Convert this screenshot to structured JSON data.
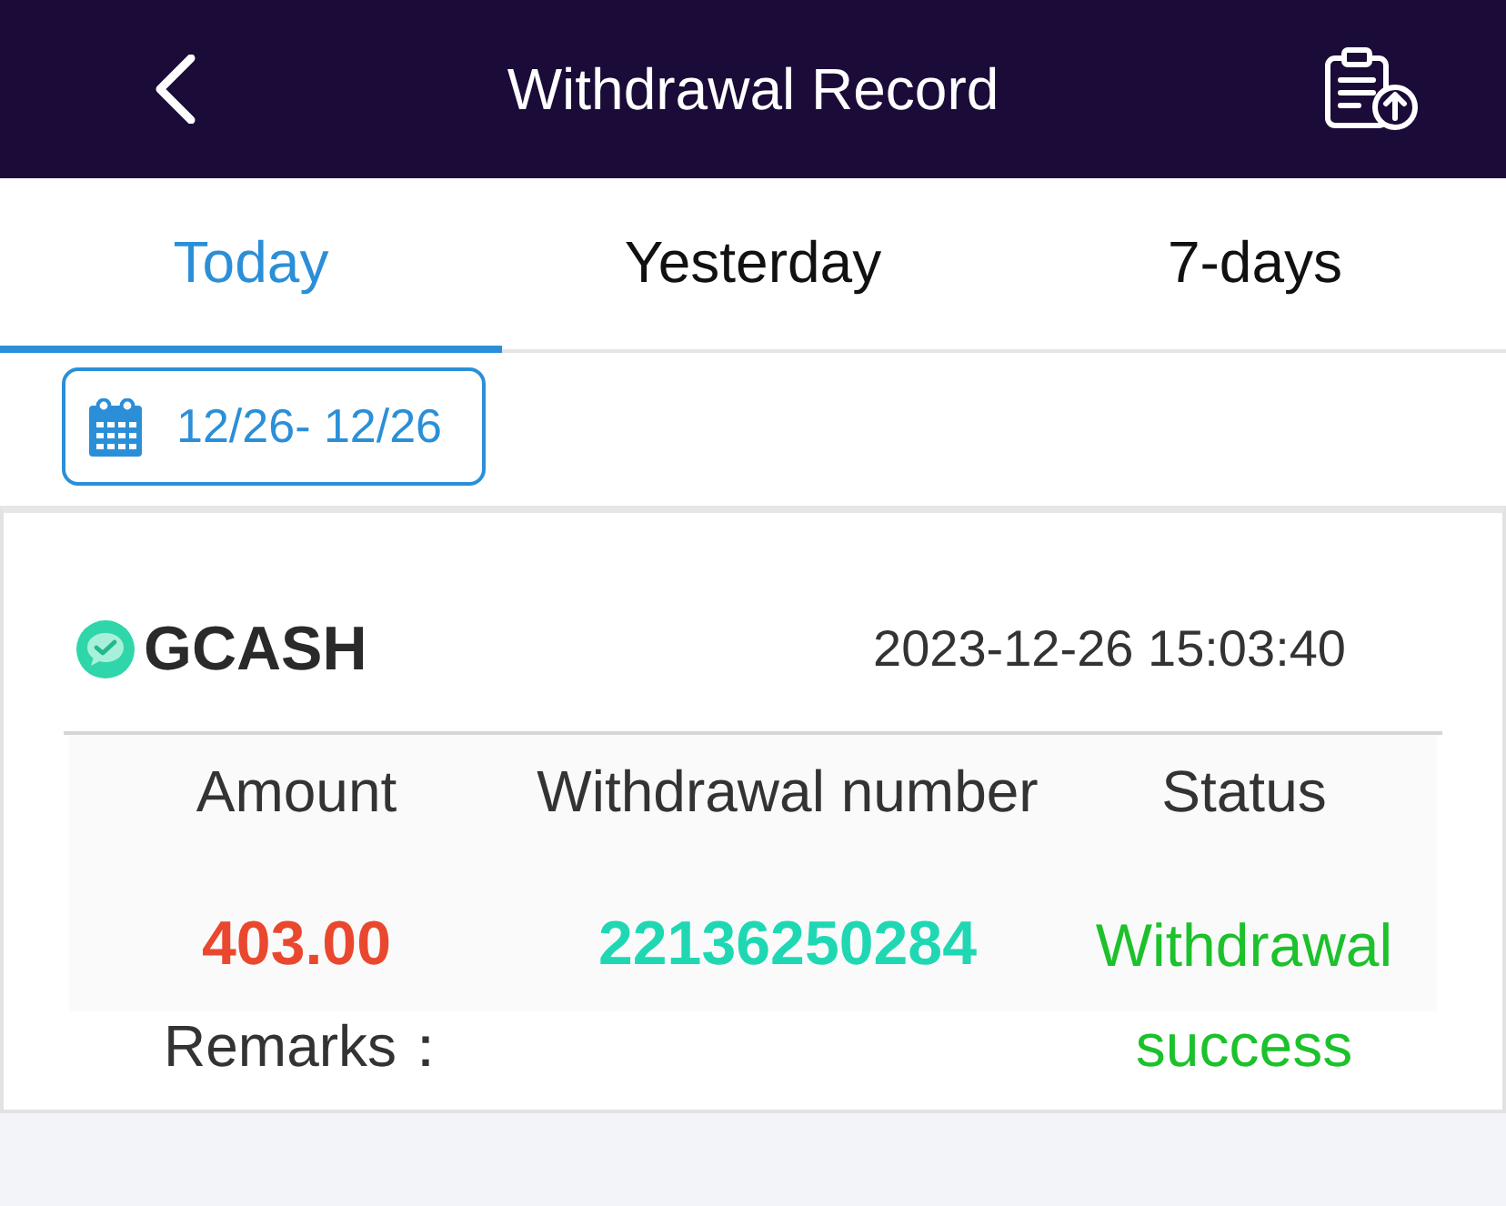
{
  "header": {
    "title": "Withdrawal Record"
  },
  "tabs": [
    {
      "label": "Today",
      "selected": true
    },
    {
      "label": "Yesterday",
      "selected": false
    },
    {
      "label": "7-days",
      "selected": false
    }
  ],
  "date_filter": {
    "label": "12/26- 12/26"
  },
  "records": [
    {
      "method": "GCASH",
      "time": "2023-12-26 15:03:40",
      "columns": [
        "Amount",
        "Withdrawal number",
        "Status"
      ],
      "amount": "403.00",
      "withdrawal_number": "22136250284",
      "status": "Withdrawal success",
      "remarks_label": "Remarks："
    }
  ]
}
